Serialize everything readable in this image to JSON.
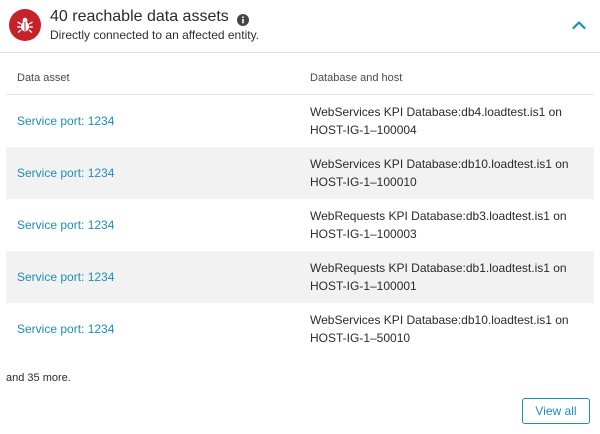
{
  "header": {
    "title": "40 reachable data assets",
    "subtitle": "Directly connected to an affected entity.",
    "badge_icon": "bug-icon",
    "info_icon": "info-icon",
    "collapse_icon": "chevron-up-icon",
    "badge_color": "#c5222a",
    "accent_color": "#1a8fb8"
  },
  "table": {
    "columns": [
      "Data asset",
      "Database and host"
    ],
    "rows": [
      {
        "asset": "Service port: 1234",
        "db_line1": "WebServices KPI Database:db4.loadtest.is1 on",
        "db_line2": "HOST-IG-1–100004"
      },
      {
        "asset": "Service port: 1234",
        "db_line1": "WebServices KPI Database:db10.loadtest.is1 on",
        "db_line2": "HOST-IG-1–100010"
      },
      {
        "asset": "Service port: 1234",
        "db_line1": "WebRequests KPI Database:db3.loadtest.is1 on",
        "db_line2": "HOST-IG-1–100003"
      },
      {
        "asset": "Service port: 1234",
        "db_line1": "WebRequests KPI Database:db1.loadtest.is1 on",
        "db_line2": "HOST-IG-1–100001"
      },
      {
        "asset": "Service port: 1234",
        "db_line1": "WebServices KPI Database:db10.loadtest.is1 on",
        "db_line2": "HOST-IG-1–50010"
      }
    ]
  },
  "footer": {
    "more_text": "and 35 more.",
    "view_all_label": "View all"
  }
}
